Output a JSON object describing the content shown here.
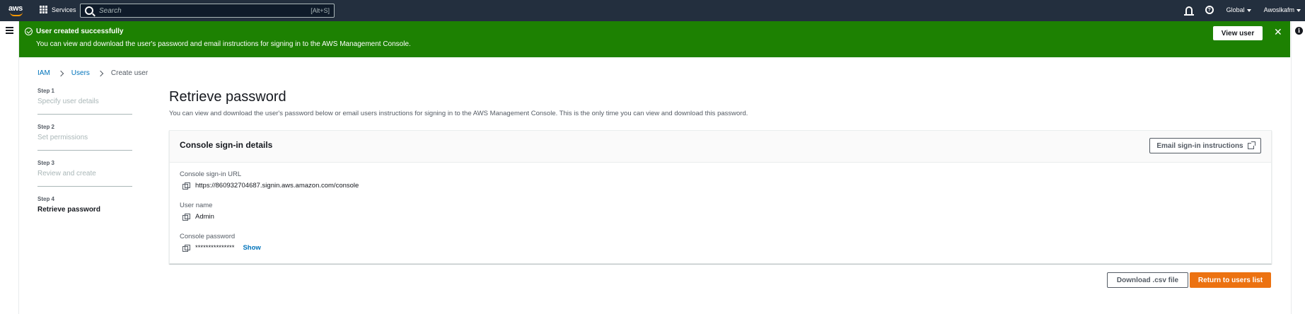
{
  "topnav": {
    "logo_text": "aws",
    "services_label": "Services",
    "search_placeholder": "Search",
    "search_shortcut": "[Alt+S]",
    "region": "Global",
    "account": "Awoslkafm"
  },
  "flash": {
    "title": "User created successfully",
    "message": "You can view and download the user's password and email instructions for signing in to the AWS Management Console.",
    "view_user_label": "View user",
    "close_glyph": "✕"
  },
  "breadcrumb": [
    "IAM",
    "Users",
    "Create user"
  ],
  "steps": [
    {
      "number": "Step 1",
      "title": "Specify user details"
    },
    {
      "number": "Step 2",
      "title": "Set permissions"
    },
    {
      "number": "Step 3",
      "title": "Review and create"
    },
    {
      "number": "Step 4",
      "title": "Retrieve password"
    }
  ],
  "page": {
    "title": "Retrieve password",
    "description": "You can view and download the user's password below or email users instructions for signing in to the AWS Management Console. This is the only time you can view and download this password."
  },
  "panel": {
    "title": "Console sign-in details",
    "email_button": "Email sign-in instructions",
    "fields": {
      "url_label": "Console sign-in URL",
      "url_value": "https://860932704687.signin.aws.amazon.com/console",
      "username_label": "User name",
      "username_value": "Admin",
      "password_label": "Console password",
      "password_value": "***************",
      "show_label": "Show"
    }
  },
  "actions": {
    "download_label": "Download .csv file",
    "return_label": "Return to users list"
  },
  "colors": {
    "nav_bg": "#232f3e",
    "flash_bg": "#1d8102",
    "primary": "#ec7211",
    "link": "#0073bb"
  }
}
